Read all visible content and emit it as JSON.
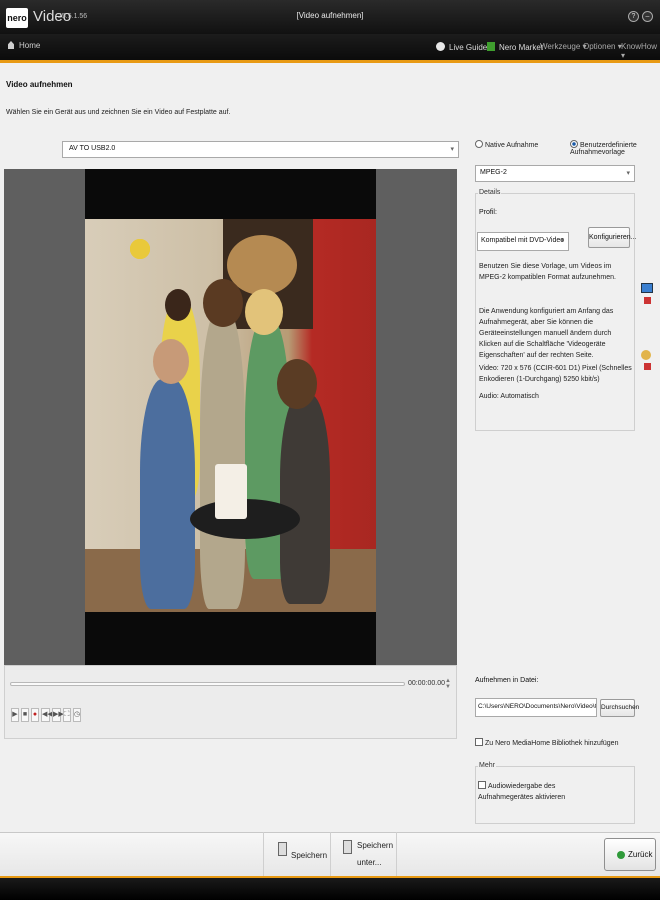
{
  "app": {
    "logo": "nero",
    "title": "Video",
    "version": "25.5.1.56",
    "window_title": "[Video aufnehmen]"
  },
  "nav": {
    "home": "Home",
    "live_guide": "Live Guide",
    "nero_market": "Nero Market",
    "werkzeuge": "Werkzeuge ▾",
    "optionen": "Optionen ▾",
    "knowhow": "KnowHow ▾"
  },
  "page": {
    "title": "Video aufnehmen",
    "instruction": "Wählen Sie ein Gerät aus und zeichnen Sie ein Video auf Festplatte auf."
  },
  "device": {
    "selected": "AV TO USB2.0"
  },
  "player": {
    "time": "00:00:00.00",
    "controls": [
      "▶",
      "■",
      "●",
      "◀◀",
      "▶▶",
      "⛶",
      "◷"
    ],
    "progress": 0
  },
  "recording": {
    "native_label": "Native Aufnahme",
    "custom_label": "Benutzerdefinierte Aufnahmevorlage",
    "selected_mode": "custom",
    "format": "MPEG-2",
    "details_label": "Details",
    "profile_label": "Profil:",
    "profile_value": "Kompatibel mit DVD-Video",
    "configure_button": "Konfigurieren...",
    "desc1": "Benutzen Sie diese Vorlage, um Videos im MPEG-2 kompatiblen Format aufzunehmen.",
    "desc2": "Die Anwendung konfiguriert am Anfang das Aufnahmegerät, aber Sie können die Geräteeinstellungen manuell ändern durch Klicken auf die Schaltfläche 'Videogeräte Eigenschaften' auf der rechten Seite.",
    "video_spec": "Video: 720 x 576 (CCIR-601 D1) Pixel (Schnelles Enkodieren (1-Durchgang) 5250 kbit/s)",
    "audio_spec": "Audio: Automatisch"
  },
  "file": {
    "label": "Aufnehmen in Datei:",
    "path": "C:\\Users\\NERO\\Documents\\Nero\\Video\\CapturedVideo\\N",
    "browse_button": "Durchsuchen",
    "library_checkbox": "Zu Nero MediaHome Bibliothek hinzufügen",
    "library_checked": false
  },
  "more": {
    "label": "Mehr",
    "audio_checkbox": "Audiowiedergabe des Aufnahmegerätes aktivieren",
    "audio_checked": false
  },
  "bottom": {
    "save": "Speichern",
    "save_as_line1": "Speichern",
    "save_as_line2": "unter...",
    "back": "Zurück"
  },
  "colors": {
    "accent": "#e89a14",
    "titlebar": "#111111",
    "market_green": "#3f9e2e"
  }
}
